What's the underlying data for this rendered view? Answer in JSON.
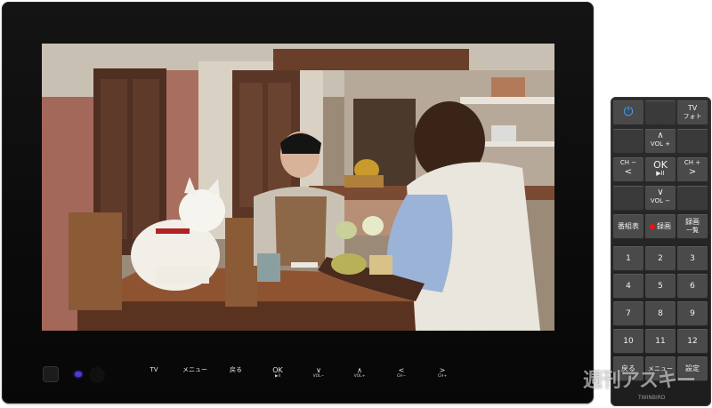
{
  "tv": {
    "buttons": [
      {
        "glyph": "",
        "label": "TV"
      },
      {
        "glyph": "",
        "label": "メニュー"
      },
      {
        "glyph": "",
        "label": "戻る"
      },
      {
        "glyph": "OK",
        "label": "▶II"
      },
      {
        "glyph": "∨",
        "label": "VOL−"
      },
      {
        "glyph": "∧",
        "label": "VOL+"
      },
      {
        "glyph": "<",
        "label": "CH−"
      },
      {
        "glyph": ">",
        "label": "CH+"
      }
    ],
    "colors": {
      "indicator": "#4b3bd6",
      "bezel": "#0b0b0b"
    }
  },
  "remote": {
    "tv_photo": {
      "top": "TV",
      "bottom": "フォト"
    },
    "vol_up": {
      "icon": "∧",
      "label": "VOL +"
    },
    "ch_minus": {
      "label": "CH −",
      "icon": "<",
      "sub": "◀◀"
    },
    "ok": {
      "label": "OK",
      "sub": "▶II"
    },
    "ch_plus": {
      "label": "CH +",
      "icon": ">",
      "sub": "▶▶"
    },
    "vol_down": {
      "icon": "∨",
      "label": "VOL −"
    },
    "guide": "番組表",
    "record": "録画",
    "rec_list": {
      "line1": "録画",
      "line2": "一覧"
    },
    "numbers": [
      "1",
      "2",
      "3",
      "4",
      "5",
      "6",
      "7",
      "8",
      "9",
      "10",
      "11",
      "12"
    ],
    "back": "戻る",
    "menu": "メニュー",
    "settings": "設定",
    "brand": "TWINBIRD",
    "power_icon": "power-icon"
  },
  "watermark": "週刊アスキー"
}
